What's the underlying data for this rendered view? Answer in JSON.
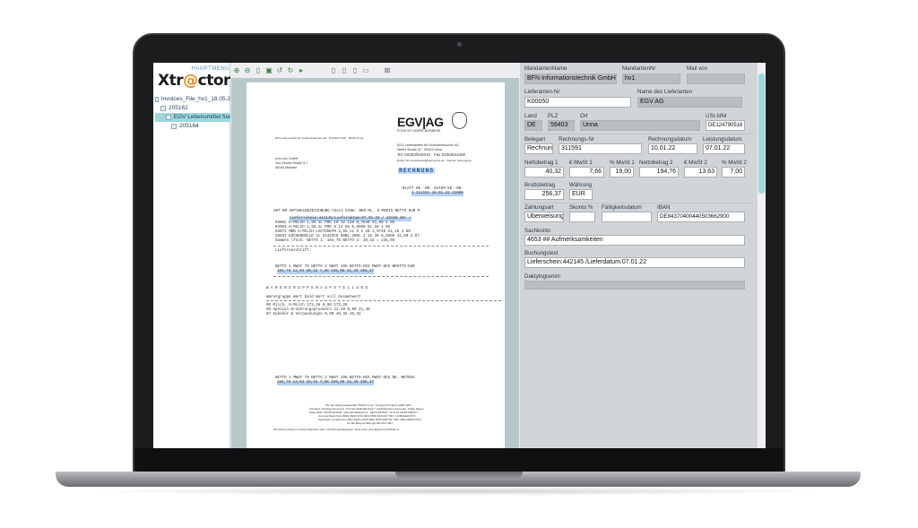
{
  "app": {
    "brand_prefix": "Xtr",
    "brand_at": "@",
    "brand_suffix": "ctor",
    "main_menu": "HAUPTMENÜ"
  },
  "tree": {
    "items": [
      {
        "label": "Invoices_File_hv1_18.05.2"
      },
      {
        "label": "205162"
      },
      {
        "label": "EGV Lebensmittel fue"
      },
      {
        "label": "205164"
      }
    ]
  },
  "document": {
    "company": "EGV|AG",
    "slogan": "FOOD IST UNSER BUSINESS",
    "sender_small": "EGV Lebensmittel für Großverbraucher AG · Postfach 1232 · 59423 Unna",
    "sender_block": [
      "EGV Lebensmittel für Großverbraucher AG",
      "Weiler Straße 42 · 59423 Unna",
      "Tel. 02303/942010 · Fax 02303/41000",
      "Email: info.einzelhandel@egv-group.de · Internet: www.egv.de"
    ],
    "recipient": [
      "ecm-one GmbH",
      "Von-Vincke-Straße 5-7",
      "48143 Münster"
    ],
    "title": "RECHNUNG",
    "meta_header": "BLATT RE.-NR.   DATUM  KD.-NR.",
    "meta_values": "1  311591  10.01.22  21909",
    "table_header": "ART-NR ARTIKELBEZEICHNUNG          COLLI EINH. BER.ML. E-PREIS  NETTO EUR M",
    "lines": [
      "Lieferschein:442145/Lieferdatum:07.01.22  / 33345    80/  /",
      "03002 H-MILCH 1,5% 1L PRG          10      12    120  0,7640   91,68 1 05",
      "03003 H-MILCH 1,5% 1L PRG           8      12     96  0,8500   81,60 1 05",
      "03073 MBN H-MILCH LACTOSEFR.3,5% 1L 9      2     20  1,0740   21,48 1 80",
      "38591 KÜCHENROLLE 2L 2X4ZOCH 50BL.2ROL  2   16     48  0,8600   41,60 2 87",
      "       Summen lfsch: NETTO 1:    194,76 NETTO 2:    40,32 =    235,08"
    ],
    "delivery_label": "Lieferanschrift:",
    "totals_header": "NETTO 1     MWST 7%   NETTO 2   MWST 19%  NETTO-GES   MWST-GES    BRUTTO-EUR",
    "totals_values": "194,76     13,63     40,32      7,66     235,08      21,29     256,37",
    "group_title": "W A R E N G R U P P E N A U F S T E L L U N G",
    "group_header": "Warengruppe                      Wert bald   Wert voll   Gesamtwert",
    "group_lines": [
      "05 Milch, H-Milch                   173,28        0,00      173,28",
      "80 Spezial-Ernährungsprodukte        21,48        0,00       21,48",
      "87 Zubehör & Verpackungen             0,00       40,32       40,32"
    ],
    "footer_header": "NETTO 1    MWST 7%   NETTO 2   MWST 19%  NETTO-GES   MWST-GES    RE.-BETRAG",
    "footer_values": "194,76     13,63     40,32      7,66     235,08      21,29     256,37",
    "legal": [
      "Sitz der Aktiengesellschaft: 59423 Unna * Amtsgericht Hamm HRB 3204",
      "Vorstand: Christian Neumann, Thomas Wallraffenstein * Aufsichtsratsvorsitzender: Frank Jaquet",
      "Steuerhilfe: 316/5720/1206 * Ust-Identifikationsnr.: DE124790516 * GLN 40 44065 00000 7",
      "Commerzbank Köln IBAN DE84 3704 0044 0503 6629 00 * BIC: COBADEFFXXX",
      "Sparkasse UnnaKamen IBAN DE04 4435 0060 0000 0420 99 * BIC: WELADED1UNN",
      "für alle Bargeschäfte gilt DE-ÖKO-001",
      "Die Lieferung erfolgt zu unseren bekannten Liefer- und Zahlungsbedingungen. Diese sehen einen Eigentumsvorbehalt vor."
    ]
  },
  "form": {
    "mandant_name": {
      "label": "MandantenName",
      "value": "BFN Informationstechnik GmbH"
    },
    "mandant_nr": {
      "label": "MandantenNr",
      "value": "hv1"
    },
    "mail_von": {
      "label": "Mail von",
      "value": ""
    },
    "lieferanten_nr": {
      "label": "Lieferanten-Nr",
      "value": "K00050"
    },
    "lieferanten_name": {
      "label": "Name des Lieferanten",
      "value": "EGV AG"
    },
    "land": {
      "label": "Land",
      "value": "DE"
    },
    "plz": {
      "label": "PLZ",
      "value": "59403"
    },
    "ort": {
      "label": "Ort",
      "value": "Unna"
    },
    "ust_idnr": {
      "label": "USt-IdNr",
      "value": "DE124790516"
    },
    "belegart": {
      "label": "Belegart",
      "value": "Rechnung"
    },
    "rechnungs_nr": {
      "label": "Rechnungs-Nr",
      "value": "311591"
    },
    "rechnungsdatum": {
      "label": "Rechnungsdatum",
      "value": "10.01.22"
    },
    "leistungsdatum": {
      "label": "Leistungsdatum",
      "value": "07.01.22"
    },
    "netto1": {
      "label": "Nettobetrag 1",
      "value": "40,32"
    },
    "mwst1": {
      "label": "€ MwSt 1",
      "value": "7,66"
    },
    "pct_mwst1": {
      "label": "% MwSt 1",
      "value": "19,00"
    },
    "netto2": {
      "label": "Nettobetrag 2",
      "value": "194,76"
    },
    "mwst2": {
      "label": "€ MwSt 2",
      "value": "13,63"
    },
    "pct_mwst2": {
      "label": "% MwSt 2",
      "value": "7,00"
    },
    "brutto": {
      "label": "Bruttobetrag",
      "value": "256,37"
    },
    "waehrung": {
      "label": "Währung",
      "value": "EUR"
    },
    "zahlungsart": {
      "label": "Zahlungsart",
      "value": "Überweisung"
    },
    "skonto": {
      "label": "Skonto %",
      "value": ""
    },
    "faelligkeit": {
      "label": "Fälligkeitsdatum",
      "value": ""
    },
    "iban": {
      "label": "IBAN",
      "value": "DE84370400440503662900"
    },
    "sachkonto": {
      "label": "Sachkonto",
      "value": "4653 ## Aufmerksamkeiten"
    },
    "buchungstext": {
      "label": "Buchungstext",
      "value": "Lieferschein:442145 /Lieferdatum:07.01.22"
    },
    "daktylogramm": {
      "label": "Daktylogramm",
      "value": ""
    }
  }
}
